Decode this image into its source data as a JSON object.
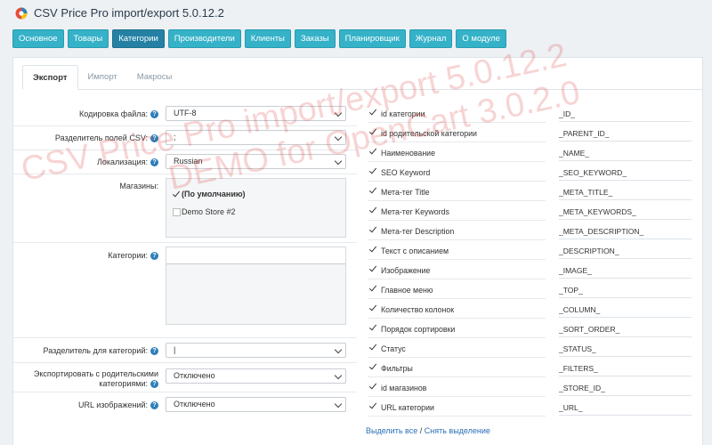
{
  "app": {
    "title": "CSV Price Pro import/export 5.0.12.2"
  },
  "mainnav": [
    {
      "label": "Основное",
      "active": false
    },
    {
      "label": "Товары",
      "active": false
    },
    {
      "label": "Категории",
      "active": true
    },
    {
      "label": "Производители",
      "active": false
    },
    {
      "label": "Клиенты",
      "active": false
    },
    {
      "label": "Заказы",
      "active": false
    },
    {
      "label": "Планировщик",
      "active": false
    },
    {
      "label": "Журнал",
      "active": false
    },
    {
      "label": "О модуле",
      "active": false
    }
  ],
  "tabs": [
    {
      "label": "Экспорт",
      "active": true
    },
    {
      "label": "Импорт",
      "active": false
    },
    {
      "label": "Макросы",
      "active": false
    }
  ],
  "form": {
    "encoding": {
      "label": "Кодировка файла:",
      "value": "UTF-8"
    },
    "delimiter": {
      "label": "Разделитель полей CSV:",
      "value": ";"
    },
    "locale": {
      "label": "Локализация:",
      "value": "Russian"
    },
    "stores": {
      "label": "Магазины:",
      "items": [
        {
          "label": "(По умолчанию)",
          "checked": true
        },
        {
          "label": "Demo Store #2",
          "checked": false
        }
      ]
    },
    "categories": {
      "label": "Категории:",
      "value": ""
    },
    "category_delimiter": {
      "label": "Разделитель для категорий:",
      "value": "|"
    },
    "export_parent": {
      "label_line1": "Экспортировать с родительскими",
      "label_line2": "категориями:",
      "value": "Отключено"
    },
    "image_url": {
      "label": "URL изображений:",
      "value": "Отключено"
    }
  },
  "columns": [
    {
      "name": "id категории",
      "code": "_ID_",
      "checked": true
    },
    {
      "name": "id родительской категории",
      "code": "_PARENT_ID_",
      "checked": true
    },
    {
      "name": "Наименование",
      "code": "_NAME_",
      "checked": true
    },
    {
      "name": "SEO Keyword",
      "code": "_SEO_KEYWORD_",
      "checked": true
    },
    {
      "name": "Мета-тег Title",
      "code": "_META_TITLE_",
      "checked": true
    },
    {
      "name": "Мета-тег Keywords",
      "code": "_META_KEYWORDS_",
      "checked": true
    },
    {
      "name": "Мета-тег Description",
      "code": "_META_DESCRIPTION_",
      "checked": true
    },
    {
      "name": "Текст с описанием",
      "code": "_DESCRIPTION_",
      "checked": true
    },
    {
      "name": "Изображение",
      "code": "_IMAGE_",
      "checked": true
    },
    {
      "name": "Главное меню",
      "code": "_TOP_",
      "checked": true
    },
    {
      "name": "Количество колонок",
      "code": "_COLUMN_",
      "checked": true
    },
    {
      "name": "Порядок сортировки",
      "code": "_SORT_ORDER_",
      "checked": true
    },
    {
      "name": "Статус",
      "code": "_STATUS_",
      "checked": true
    },
    {
      "name": "Фильтры",
      "code": "_FILTERS_",
      "checked": true
    },
    {
      "name": "id магазинов",
      "code": "_STORE_ID_",
      "checked": true
    },
    {
      "name": "URL категории",
      "code": "_URL_",
      "checked": true
    }
  ],
  "links": {
    "select_all": "Выделить все",
    "separator": "/",
    "deselect": "Снять выделение"
  },
  "watermark": {
    "line1": "CSV Price Pro import/export 5.0.12.2",
    "line2": "DEMO for OpenCart 3.0.2.0"
  },
  "colors": {
    "nav": "#35b2c8",
    "nav_active": "#2481a4",
    "link": "#2a6fb6",
    "watermark": "#dc3c3c"
  }
}
